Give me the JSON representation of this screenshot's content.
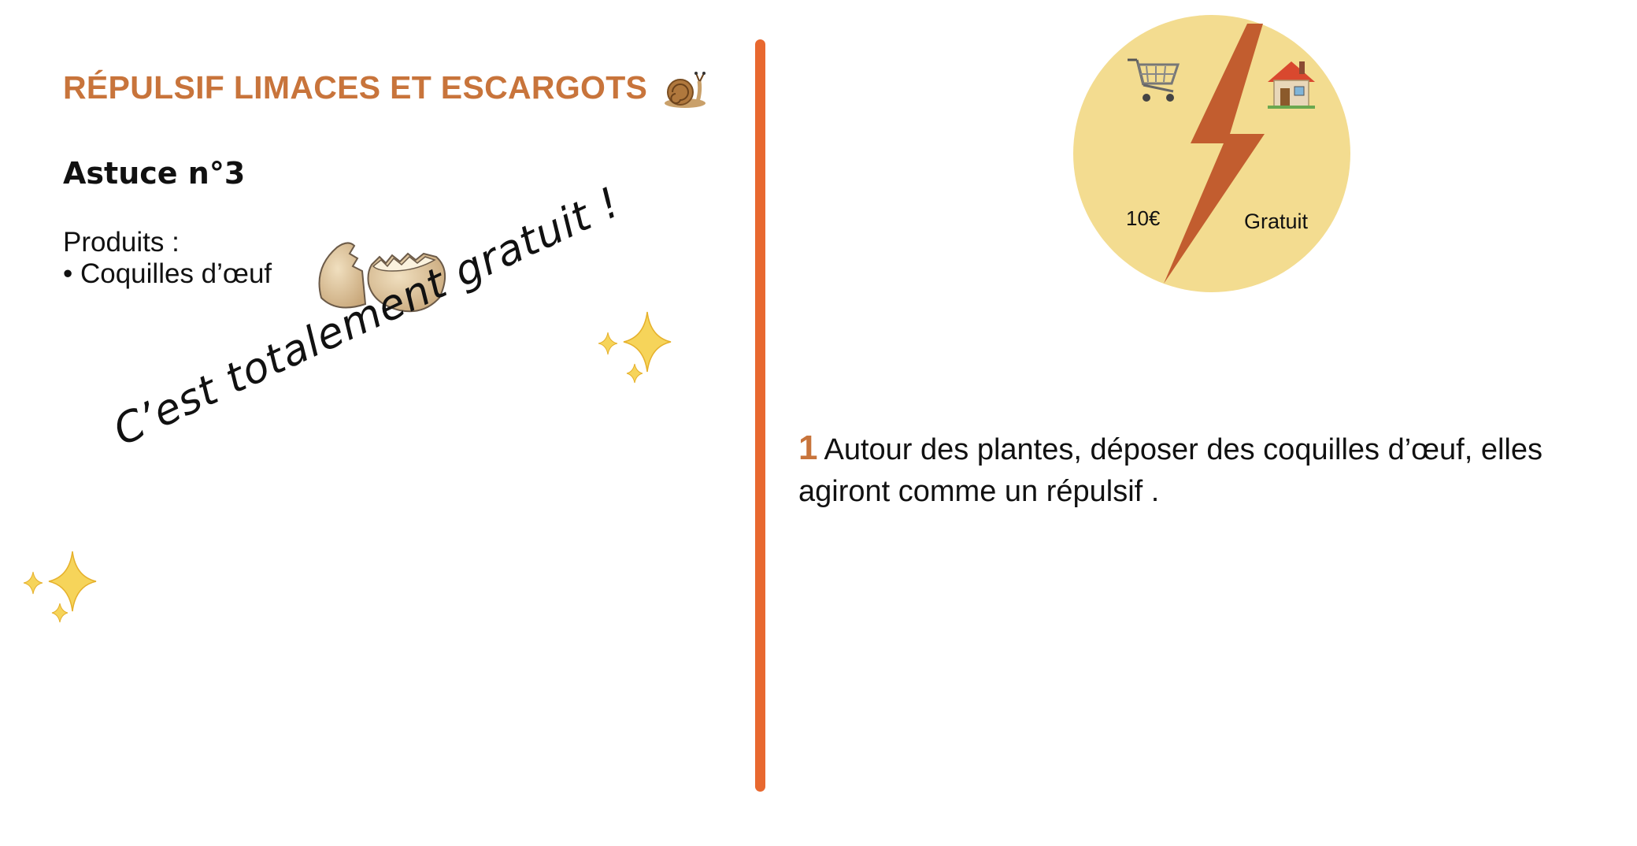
{
  "page": {
    "title": "RÉPULSIF LIMACES ET ESCARGOTS",
    "subtitle": "Astuce n°3"
  },
  "products": {
    "label": "Produits :",
    "items": [
      "• Coquilles d’œuf"
    ]
  },
  "note": "C’est totalement gratuit !",
  "badge": {
    "store_price": "10€",
    "home_price": "Gratuit",
    "left_icon": "shopping-cart-icon",
    "right_icon": "house-icon",
    "center_icon": "lightning-icon"
  },
  "steps": [
    {
      "number": "1",
      "text": "Autour des plantes, déposer des coquilles d’œuf, elles agiront comme un répulsif ."
    }
  ],
  "colors": {
    "title": "#c8743b",
    "divider": "#e8682f",
    "badge_fill": "#f3dc90",
    "lightning": "#c25d2f"
  }
}
